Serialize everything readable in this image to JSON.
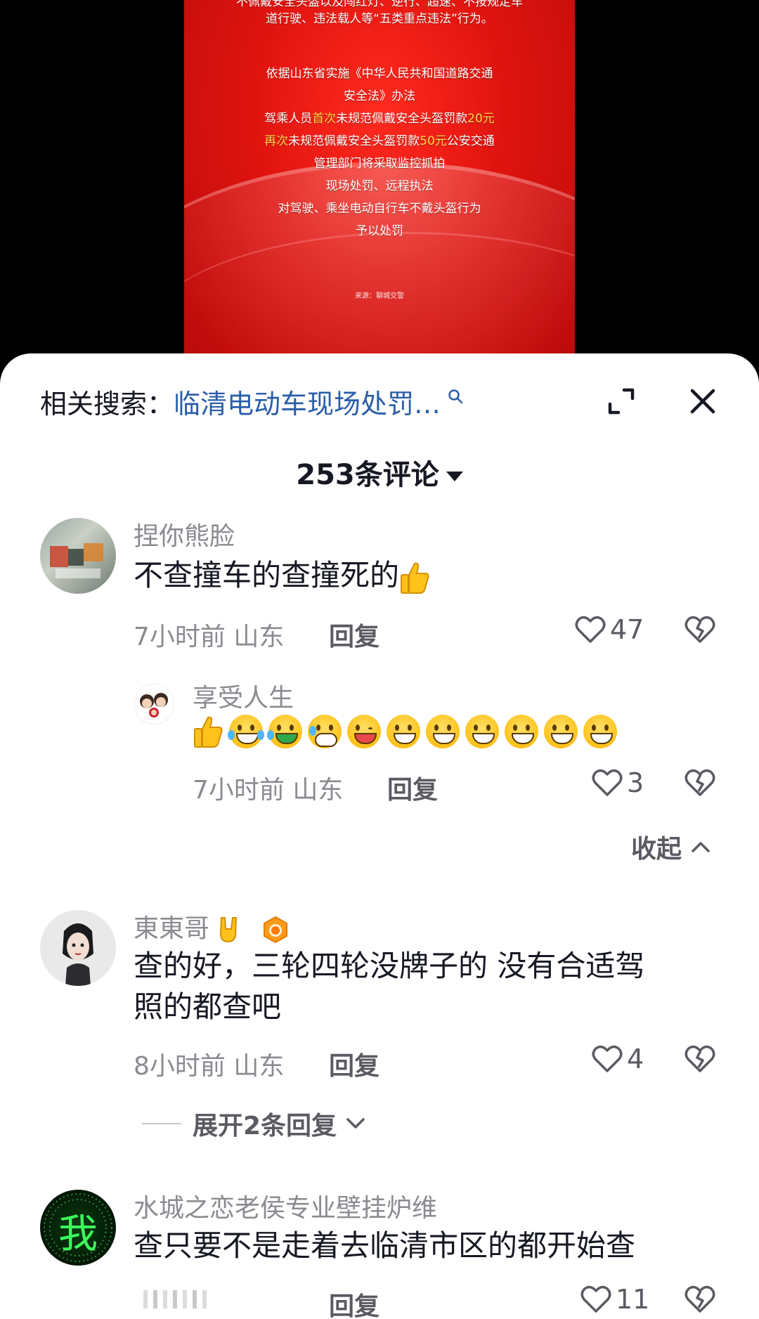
{
  "poster": {
    "top_line_1": "不佩戴安全头盔以及闯红灯、逆行、超速、不按规定车",
    "top_line_2": "道行驶、违法载人等“五类重点违法”行为。",
    "law_line_1": "依据山东省实施《中华人民共和国道路交通",
    "law_line_2": "安全法》办法",
    "fine_line_1_a": "驾乘人员",
    "fine_line_1_b": "首次",
    "fine_line_1_c": "未规范佩戴安全头盔罚款",
    "fine_line_1_d": "20元",
    "fine_line_2_a": "再次",
    "fine_line_2_b": "未规范佩戴安全头盔罚款",
    "fine_line_2_c": "50元",
    "fine_line_2_d": "公安交通",
    "line_manage": "管理部门将采取监控抓拍",
    "line_onsite": "现场处罚、远程执法",
    "line_target": "对驾驶、乘坐电动自行车不戴头盔行为",
    "line_punish": "予以处罚",
    "source": "来源：聊城交警",
    "highlight_color": "#ffd84a"
  },
  "sheet": {
    "related_label": "相关搜索：",
    "related_query": "临清电动车现场处罚…",
    "comment_count": "253条评论"
  },
  "comments": [
    {
      "username": "捏你熊脸",
      "text": "不查撞车的查撞死的",
      "time": "7小时前",
      "location": "山东",
      "reply": "回复",
      "likes": "47",
      "replies": [
        {
          "username": "享受人生",
          "time": "7小时前",
          "location": "山东",
          "reply": "回复",
          "likes": "3"
        }
      ],
      "collapse": "收起"
    },
    {
      "username": "東東哥",
      "text_line_1": "查的好，三轮四轮没牌子的  没有合适驾",
      "text_line_2": "照的都查吧",
      "time": "8小时前",
      "location": "山东",
      "reply": "回复",
      "likes": "4",
      "expand": "展开2条回复"
    },
    {
      "username": "水城之恋老侯专业壁挂炉维",
      "text": "查只要不是走着去临清市区的都开始查",
      "avatar_text": "我",
      "reply": "回复",
      "likes": "11"
    }
  ]
}
